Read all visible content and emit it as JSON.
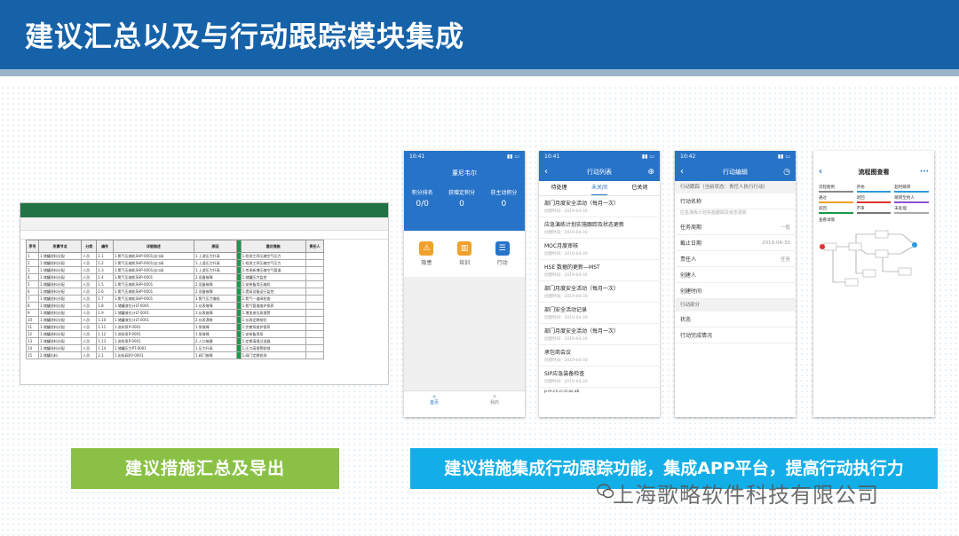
{
  "slide": {
    "title": "建议汇总以及与行动跟踪模块集成",
    "label_left": "建议措施汇总及导出",
    "label_right": "建议措施集成行动跟踪功能，集成APP平台，提高行动执行力",
    "watermark": "上海歌略软件科技有限公司"
  },
  "spreadsheet": {
    "headers": [
      "序号",
      "所属节点",
      "分类",
      "编号",
      "详细描述",
      "原因",
      "",
      "建议措施",
      "责任人"
    ],
    "rows": [
      [
        "1",
        "1.储罐进料分配",
        "人员",
        "1.1",
        "1.氮气压缩机SHP-0001出口阀",
        "1.上游压力升高",
        "",
        "1.检测工序压缩空气压力",
        ""
      ],
      [
        "2",
        "1.储罐进料分配",
        "人员",
        "1.2",
        "1.氮气压缩机SHP-0001出口阀",
        "1.上游压力升高",
        "",
        "1.检测工序压缩空气压力",
        ""
      ],
      [
        "3",
        "1.储罐进料分配",
        "人员",
        "1.3",
        "1.氮气压缩机SHP-0001出口阀",
        "1.上游压力升高",
        "",
        "1.考虑新增压缩空气管道",
        ""
      ],
      [
        "4",
        "1.储罐进料分配",
        "人员",
        "1.4",
        "1.氮气压缩机SHP-0001",
        "2.设备故障",
        "",
        "1.储罐压力监控",
        ""
      ],
      [
        "5",
        "1.储罐进料分配",
        "人员",
        "1.5",
        "1.氮气压缩机SHP-0001",
        "2.设备故障",
        "",
        "1.安装备用压缩机",
        ""
      ],
      [
        "6",
        "1.储罐进料分配",
        "人员",
        "1.6",
        "1.氮气压缩机SHP-0001",
        "2.设备故障",
        "",
        "1.提高设备运行监控",
        ""
      ],
      [
        "7",
        "1.储罐进料分配",
        "人员",
        "1.7",
        "1.氮气压缩机SHP-0001",
        "3.氮气压力偏低",
        "",
        "1.氮气一道阀检查",
        ""
      ],
      [
        "8",
        "1.储罐进料分配",
        "人员",
        "1.8",
        "1.储罐液位计LT-0001",
        "1.仪表故障",
        "",
        "1.氮气管道维护保养",
        ""
      ],
      [
        "9",
        "1.储罐进料分配",
        "人员",
        "1.9",
        "1.储罐液位计LT-0001",
        "1.仪表故障",
        "",
        "1.增加液位高报警",
        ""
      ],
      [
        "10",
        "1.储罐进料分配",
        "人员",
        "1.10",
        "1.储罐液位计LT-0001",
        "2.仪表漂移",
        "",
        "1.仪表定期校验",
        ""
      ],
      [
        "11",
        "1.储罐进料分配",
        "人员",
        "1.11",
        "1.进料泵P-0001",
        "1.泵故障",
        "",
        "1.完善泵维护保养",
        ""
      ],
      [
        "12",
        "1.储罐进料分配",
        "人员",
        "1.12",
        "1.进料泵P-0001",
        "1.泵故障",
        "",
        "1.安装备用泵",
        ""
      ],
      [
        "13",
        "1.储罐进料分配",
        "人员",
        "1.13",
        "1.进料泵P-0001",
        "2.入口堵塞",
        "",
        "1.定期清理过滤器",
        ""
      ],
      [
        "14",
        "1.储罐进料分配",
        "人员",
        "1.14",
        "1.储罐压力PT-0001",
        "1.压力升高",
        "",
        "1.压力高报警联锁",
        ""
      ],
      [
        "15",
        "2.储罐出料",
        "人员",
        "2.1",
        "1.出料阀XV-0001",
        "1.阀门故障",
        "",
        "1.阀门定期检测",
        ""
      ]
    ]
  },
  "phone1": {
    "time": "10:41",
    "user_name": "董尼韦尔",
    "stats": [
      {
        "label": "积分排名",
        "value": "0/0"
      },
      {
        "label": "获赠定积分",
        "value": "0"
      },
      {
        "label": "获主动积分",
        "value": "0"
      }
    ],
    "modules": [
      {
        "label": "隐患",
        "color": "#f0a12c",
        "icon": "⚠"
      },
      {
        "label": "培训",
        "color": "#f0a12c",
        "icon": "▥"
      },
      {
        "label": "行动",
        "color": "#2773c8",
        "icon": "☰"
      }
    ],
    "nav": [
      {
        "label": "首页"
      },
      {
        "label": "我的"
      }
    ]
  },
  "phone2": {
    "time": "10:41",
    "title": "行动列表",
    "tabs": [
      "待处理",
      "未关闭",
      "已关闭"
    ],
    "tasks": [
      {
        "title": "部门月度安全活动（每月一次）",
        "meta": "创建时间：2019-04-30"
      },
      {
        "title": "应急演练计划实施跟踪及状态更新",
        "meta": "创建时间：2019-04-30"
      },
      {
        "title": "MOC月度审核",
        "meta": "创建时间：2019-04-30"
      },
      {
        "title": "HSE 数据的更新—MST",
        "meta": "创建时间：2019-04-30"
      },
      {
        "title": "部门月度安全活动（每月一次）",
        "meta": "创建时间：2019-04-30"
      },
      {
        "title": "部门安全活动记录",
        "meta": "创建时间：2019-04-30"
      },
      {
        "title": "部门月度安全活动（每月一次）",
        "meta": "创建时间：2019-04-30"
      },
      {
        "title": "承包商会议",
        "meta": "创建时间：2019-04-30"
      },
      {
        "title": "SIP应急装备检查",
        "meta": "创建时间：2019-04-30"
      }
    ],
    "footer": "p.m.cn.cr.sl.as.ab"
  },
  "phone3": {
    "time": "10:42",
    "title": "行动编辑",
    "section_note": "行动跟踪（当前状态：责任人执行行动）",
    "rows": [
      {
        "label": "行动名称",
        "value": ""
      },
      {
        "label": "任务周期",
        "value": "一般"
      },
      {
        "label": "截止日期",
        "value": "2019-04-30"
      },
      {
        "label": "责任人",
        "value": "任务"
      },
      {
        "label": "创建人",
        "value": ""
      },
      {
        "label": "创建时间",
        "value": ""
      }
    ],
    "name_value": "应急演练计划实施跟踪及状态更新",
    "section2": "行动部分",
    "rows2": [
      {
        "label": "状态",
        "value": ""
      },
      {
        "label": "行动完成情况",
        "value": ""
      }
    ]
  },
  "phone4": {
    "time": "",
    "title": "流程图查看",
    "legend": [
      {
        "label": "流程图例",
        "color": "#888"
      },
      {
        "label": "开始",
        "color": "#2d9be0"
      },
      {
        "label": "超时跳转",
        "color": "#2d9be0"
      },
      {
        "label": "通过",
        "color": "#f0a12c"
      },
      {
        "label": "退回",
        "color": "#d33"
      },
      {
        "label": "跳转至他人",
        "color": "#8a4fd6"
      },
      {
        "label": "驳回",
        "color": "#1a9a4a"
      },
      {
        "label": "不审",
        "color": "#777"
      },
      {
        "label": "未处理",
        "color": "#aaa"
      }
    ],
    "note": "查看详情"
  },
  "colors": {
    "header": "#1662a8",
    "green": "#8ac145",
    "blue": "#12aee8",
    "app_blue": "#2773c8"
  }
}
